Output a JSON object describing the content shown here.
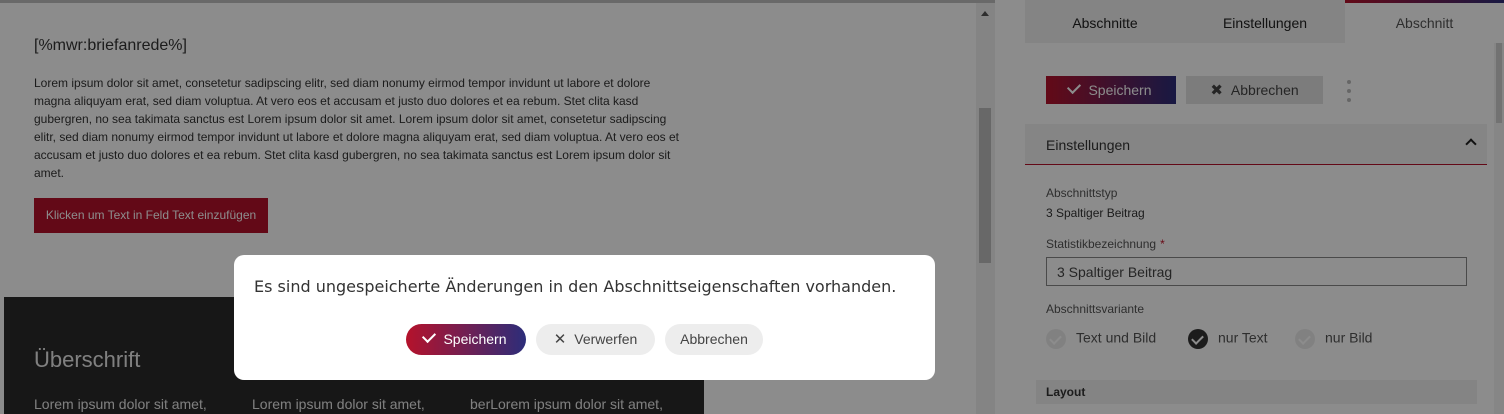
{
  "editor": {
    "anrede": "[%mwr:briefanrede%]",
    "paragraph": "Lorem ipsum dolor sit amet, consetetur sadipscing elitr, sed diam nonumy eirmod tempor invidunt ut labore et dolore magna aliquyam erat, sed diam voluptua. At vero eos et accusam et justo duo dolores et ea rebum. Stet clita kasd gubergren, no sea takimata sanctus est Lorem ipsum dolor sit amet. Lorem ipsum dolor sit amet, consetetur sadipscing elitr, sed diam nonumy eirmod tempor invidunt ut labore et dolore magna aliquyam erat, sed diam voluptua. At vero eos et accusam et justo duo dolores et ea rebum. Stet clita kasd gubergren, no sea takimata sanctus est Lorem ipsum dolor sit amet.",
    "cta_label": "Klicken um Text in Feld Text einzufügen",
    "dark_heading": "Überschrift",
    "columns": [
      "Lorem ipsum dolor sit amet,",
      "Lorem ipsum dolor sit amet,",
      "berLorem ipsum dolor sit amet,"
    ]
  },
  "panel": {
    "tabs": [
      "Abschnitte",
      "Einstellungen",
      "Abschnitt"
    ],
    "active_tab": "Abschnitt",
    "save_label": "Speichern",
    "cancel_label": "Abbrechen",
    "section_title": "Einstellungen",
    "type_label": "Abschnittstyp",
    "type_value": "3 Spaltiger Beitrag",
    "stat_label": "Statistikbezeichnung",
    "stat_required": "*",
    "stat_value": "3 Spaltiger Beitrag",
    "variant_label": "Abschnittsvariante",
    "variants": [
      "Text und Bild",
      "nur Text",
      "nur Bild"
    ],
    "selected_variant": "nur Text",
    "layout_label": "Layout"
  },
  "modal": {
    "message": "Es sind ungespeicherte Änderungen in den Abschnittseigenschaften vorhanden.",
    "save_label": "Speichern",
    "discard_label": "Verwerfen",
    "cancel_label": "Abbrechen"
  },
  "colors": {
    "accent_red": "#b5122b",
    "accent_blue": "#2c2d7a"
  }
}
